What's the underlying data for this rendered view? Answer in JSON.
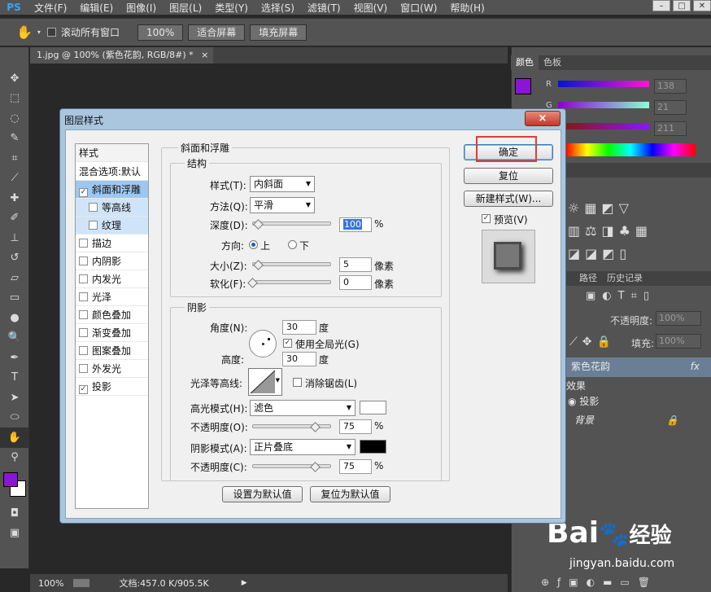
{
  "menubar": {
    "logo": "PS",
    "items": [
      "文件(F)",
      "编辑(E)",
      "图像(I)",
      "图层(L)",
      "类型(Y)",
      "选择(S)",
      "滤镜(T)",
      "视图(V)",
      "窗口(W)",
      "帮助(H)"
    ]
  },
  "options": {
    "scroll_all": "滚动所有窗口",
    "zoom": "100%",
    "fit_screen": "适合屏幕",
    "fill_screen": "填充屏幕"
  },
  "document": {
    "tab": "1.jpg @ 100% (紫色花韵, RGB/8#) *",
    "tab_close": "×",
    "status_zoom": "100%",
    "status_doc": "文档:457.0 K/905.5K"
  },
  "panels": {
    "color_tab": "颜色",
    "swatches_tab": "色板",
    "r_label": "R",
    "g_label": "G",
    "r_value": "138",
    "g_value": "21",
    "b_value": "211",
    "paths_tab": "路径",
    "history_tab": "历史记录",
    "opacity_label": "不透明度:",
    "opacity_value": "100%",
    "fill_label": "填充:",
    "fill_value": "100%",
    "layer_name": "紫色花韵",
    "fx": "fx",
    "effects": "效果",
    "drop_shadow": "投影",
    "background": "背景"
  },
  "dialog": {
    "title": "图层样式",
    "close": "×",
    "styles_header": "样式",
    "blend_default": "混合选项:默认",
    "style_items": [
      {
        "label": "斜面和浮雕",
        "checked": true
      },
      {
        "label": "等高线",
        "checked": false
      },
      {
        "label": "纹理",
        "checked": false
      },
      {
        "label": "描边",
        "checked": false
      },
      {
        "label": "内阴影",
        "checked": false
      },
      {
        "label": "内发光",
        "checked": false
      },
      {
        "label": "光泽",
        "checked": false
      },
      {
        "label": "颜色叠加",
        "checked": false
      },
      {
        "label": "渐变叠加",
        "checked": false
      },
      {
        "label": "图案叠加",
        "checked": false
      },
      {
        "label": "外发光",
        "checked": false
      },
      {
        "label": "投影",
        "checked": true
      }
    ],
    "bevel": {
      "group_title": "斜面和浮雕",
      "structure_title": "结构",
      "style_label": "样式(T):",
      "style_value": "内斜面",
      "technique_label": "方法(Q):",
      "technique_value": "平滑",
      "depth_label": "深度(D):",
      "depth_value": "100",
      "depth_fraction": 0.0,
      "direction_label": "方向:",
      "dir_up": "上",
      "dir_down": "下",
      "size_label": "大小(Z):",
      "size_value": "5",
      "size_fraction": 0.02,
      "soften_label": "软化(F):",
      "soften_value": "0",
      "soften_fraction": 0.0,
      "percent": "%",
      "pixels": "像素"
    },
    "shading": {
      "title": "阴影",
      "angle_label": "角度(N):",
      "angle_value": "30",
      "degree": "度",
      "global_light": "使用全局光(G)",
      "altitude_label": "高度:",
      "altitude_value": "30",
      "gloss_label": "光泽等高线:",
      "anti_alias": "消除锯齿(L)",
      "highlight_label": "高光模式(H):",
      "highlight_value": "滤色",
      "highlight_color": "#ffffff",
      "h_opacity_label": "不透明度(O):",
      "h_opacity_value": "75",
      "h_opacity_fraction": 0.75,
      "shadow_label": "阴影模式(A):",
      "shadow_value": "正片叠底",
      "shadow_color": "#000000",
      "s_opacity_label": "不透明度(C):",
      "s_opacity_value": "75",
      "s_opacity_fraction": 0.75
    },
    "make_default": "设置为默认值",
    "reset_default": "复位为默认值",
    "ok": "确定",
    "reset": "复位",
    "new_style": "新建样式(W)...",
    "preview": "预览(V)"
  },
  "watermark": {
    "brand": "Bai",
    "brand2": "经验",
    "url": "jingyan.baidu.com"
  },
  "colors": {
    "accent": "#8a15d3",
    "highlight_box": "#e53935"
  }
}
